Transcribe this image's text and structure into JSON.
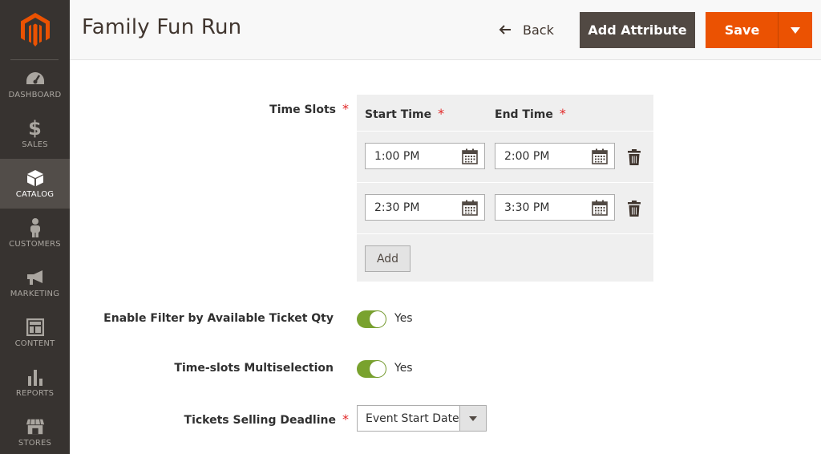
{
  "sidebar": {
    "logo": "magento-logo",
    "items": [
      {
        "label": "DASHBOARD",
        "icon": "dashboard-gauge-icon",
        "active": false
      },
      {
        "label": "SALES",
        "icon": "dollar-icon",
        "active": false
      },
      {
        "label": "CATALOG",
        "icon": "box-icon",
        "active": true
      },
      {
        "label": "CUSTOMERS",
        "icon": "person-icon",
        "active": false
      },
      {
        "label": "MARKETING",
        "icon": "megaphone-icon",
        "active": false
      },
      {
        "label": "CONTENT",
        "icon": "layout-icon",
        "active": false
      },
      {
        "label": "REPORTS",
        "icon": "bar-chart-icon",
        "active": false
      },
      {
        "label": "STORES",
        "icon": "store-icon",
        "active": false
      }
    ]
  },
  "header": {
    "title": "Family Fun Run",
    "back_label": "Back",
    "add_attribute_label": "Add Attribute",
    "save_label": "Save"
  },
  "form": {
    "time_slots": {
      "label": "Time Slots",
      "required": "*",
      "start_header": "Start Time",
      "end_header": "End Time",
      "rows": [
        {
          "start": "1:00 PM",
          "end": "2:00 PM"
        },
        {
          "start": "2:30 PM",
          "end": "3:30 PM"
        }
      ],
      "add_label": "Add"
    },
    "enable_filter": {
      "label": "Enable Filter by Available Ticket Qty",
      "value": "Yes",
      "on": true
    },
    "multiselection": {
      "label": "Time-slots Multiselection",
      "value": "Yes",
      "on": true
    },
    "deadline": {
      "label": "Tickets Selling Deadline",
      "required": "*",
      "value": "Event Start Date"
    }
  },
  "colors": {
    "sidebar_bg": "#373330",
    "active_bg": "#524d49",
    "accent": "#eb5202",
    "toggle_on": "#79a22e",
    "required": "#e22626"
  }
}
